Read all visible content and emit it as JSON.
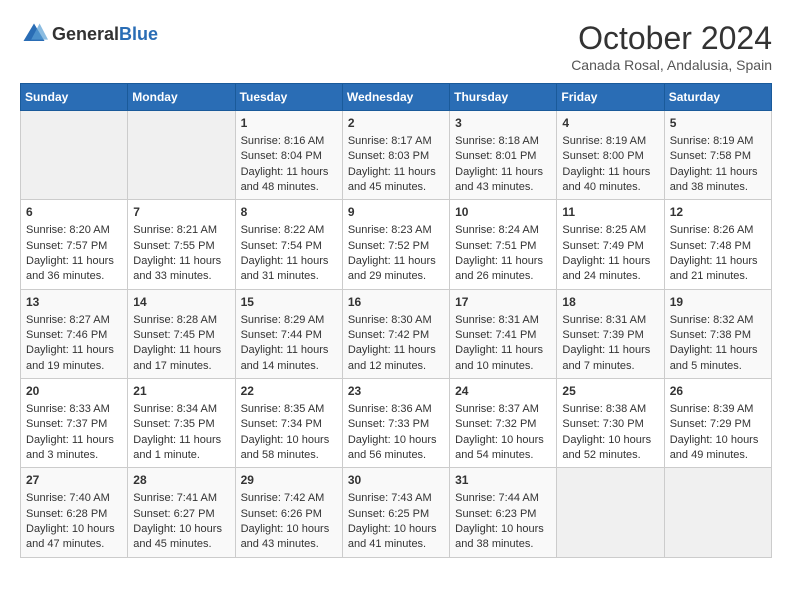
{
  "header": {
    "logo": {
      "general": "General",
      "blue": "Blue"
    },
    "title": "October 2024",
    "subtitle": "Canada Rosal, Andalusia, Spain"
  },
  "days_of_week": [
    "Sunday",
    "Monday",
    "Tuesday",
    "Wednesday",
    "Thursday",
    "Friday",
    "Saturday"
  ],
  "weeks": [
    [
      {
        "day": "",
        "content": ""
      },
      {
        "day": "",
        "content": ""
      },
      {
        "day": "1",
        "content": "Sunrise: 8:16 AM\nSunset: 8:04 PM\nDaylight: 11 hours and 48 minutes."
      },
      {
        "day": "2",
        "content": "Sunrise: 8:17 AM\nSunset: 8:03 PM\nDaylight: 11 hours and 45 minutes."
      },
      {
        "day": "3",
        "content": "Sunrise: 8:18 AM\nSunset: 8:01 PM\nDaylight: 11 hours and 43 minutes."
      },
      {
        "day": "4",
        "content": "Sunrise: 8:19 AM\nSunset: 8:00 PM\nDaylight: 11 hours and 40 minutes."
      },
      {
        "day": "5",
        "content": "Sunrise: 8:19 AM\nSunset: 7:58 PM\nDaylight: 11 hours and 38 minutes."
      }
    ],
    [
      {
        "day": "6",
        "content": "Sunrise: 8:20 AM\nSunset: 7:57 PM\nDaylight: 11 hours and 36 minutes."
      },
      {
        "day": "7",
        "content": "Sunrise: 8:21 AM\nSunset: 7:55 PM\nDaylight: 11 hours and 33 minutes."
      },
      {
        "day": "8",
        "content": "Sunrise: 8:22 AM\nSunset: 7:54 PM\nDaylight: 11 hours and 31 minutes."
      },
      {
        "day": "9",
        "content": "Sunrise: 8:23 AM\nSunset: 7:52 PM\nDaylight: 11 hours and 29 minutes."
      },
      {
        "day": "10",
        "content": "Sunrise: 8:24 AM\nSunset: 7:51 PM\nDaylight: 11 hours and 26 minutes."
      },
      {
        "day": "11",
        "content": "Sunrise: 8:25 AM\nSunset: 7:49 PM\nDaylight: 11 hours and 24 minutes."
      },
      {
        "day": "12",
        "content": "Sunrise: 8:26 AM\nSunset: 7:48 PM\nDaylight: 11 hours and 21 minutes."
      }
    ],
    [
      {
        "day": "13",
        "content": "Sunrise: 8:27 AM\nSunset: 7:46 PM\nDaylight: 11 hours and 19 minutes."
      },
      {
        "day": "14",
        "content": "Sunrise: 8:28 AM\nSunset: 7:45 PM\nDaylight: 11 hours and 17 minutes."
      },
      {
        "day": "15",
        "content": "Sunrise: 8:29 AM\nSunset: 7:44 PM\nDaylight: 11 hours and 14 minutes."
      },
      {
        "day": "16",
        "content": "Sunrise: 8:30 AM\nSunset: 7:42 PM\nDaylight: 11 hours and 12 minutes."
      },
      {
        "day": "17",
        "content": "Sunrise: 8:31 AM\nSunset: 7:41 PM\nDaylight: 11 hours and 10 minutes."
      },
      {
        "day": "18",
        "content": "Sunrise: 8:31 AM\nSunset: 7:39 PM\nDaylight: 11 hours and 7 minutes."
      },
      {
        "day": "19",
        "content": "Sunrise: 8:32 AM\nSunset: 7:38 PM\nDaylight: 11 hours and 5 minutes."
      }
    ],
    [
      {
        "day": "20",
        "content": "Sunrise: 8:33 AM\nSunset: 7:37 PM\nDaylight: 11 hours and 3 minutes."
      },
      {
        "day": "21",
        "content": "Sunrise: 8:34 AM\nSunset: 7:35 PM\nDaylight: 11 hours and 1 minute."
      },
      {
        "day": "22",
        "content": "Sunrise: 8:35 AM\nSunset: 7:34 PM\nDaylight: 10 hours and 58 minutes."
      },
      {
        "day": "23",
        "content": "Sunrise: 8:36 AM\nSunset: 7:33 PM\nDaylight: 10 hours and 56 minutes."
      },
      {
        "day": "24",
        "content": "Sunrise: 8:37 AM\nSunset: 7:32 PM\nDaylight: 10 hours and 54 minutes."
      },
      {
        "day": "25",
        "content": "Sunrise: 8:38 AM\nSunset: 7:30 PM\nDaylight: 10 hours and 52 minutes."
      },
      {
        "day": "26",
        "content": "Sunrise: 8:39 AM\nSunset: 7:29 PM\nDaylight: 10 hours and 49 minutes."
      }
    ],
    [
      {
        "day": "27",
        "content": "Sunrise: 7:40 AM\nSunset: 6:28 PM\nDaylight: 10 hours and 47 minutes."
      },
      {
        "day": "28",
        "content": "Sunrise: 7:41 AM\nSunset: 6:27 PM\nDaylight: 10 hours and 45 minutes."
      },
      {
        "day": "29",
        "content": "Sunrise: 7:42 AM\nSunset: 6:26 PM\nDaylight: 10 hours and 43 minutes."
      },
      {
        "day": "30",
        "content": "Sunrise: 7:43 AM\nSunset: 6:25 PM\nDaylight: 10 hours and 41 minutes."
      },
      {
        "day": "31",
        "content": "Sunrise: 7:44 AM\nSunset: 6:23 PM\nDaylight: 10 hours and 38 minutes."
      },
      {
        "day": "",
        "content": ""
      },
      {
        "day": "",
        "content": ""
      }
    ]
  ]
}
